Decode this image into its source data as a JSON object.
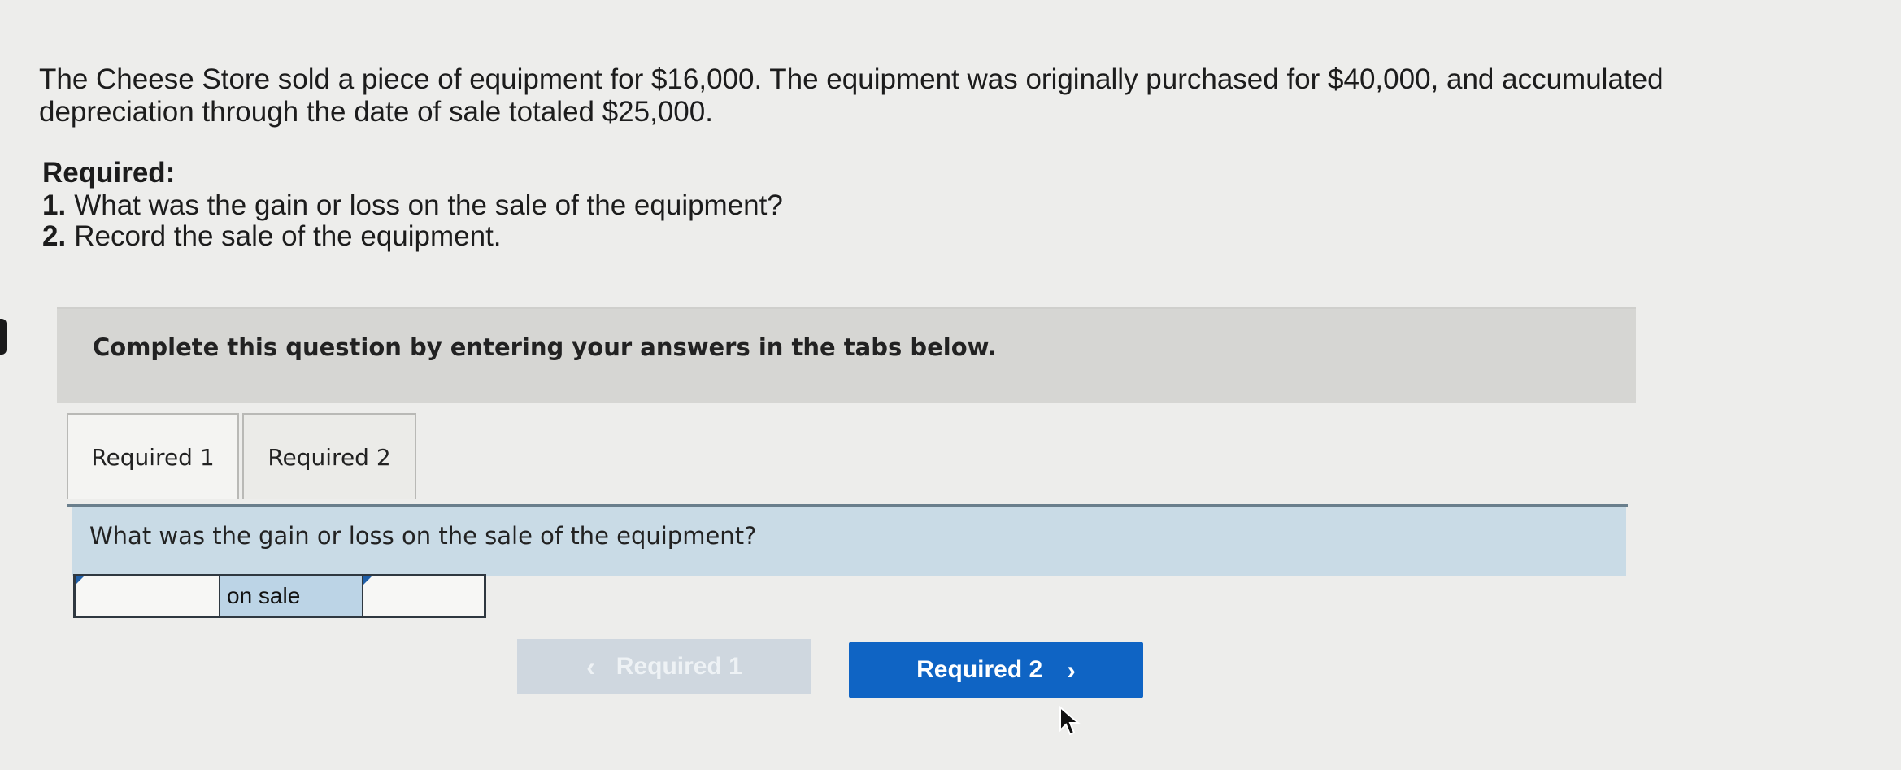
{
  "problem": {
    "text": "The Cheese Store sold a piece of equipment for $16,000. The equipment was originally purchased for $40,000, and accumulated depreciation through the date of sale totaled $25,000."
  },
  "required": {
    "title": "Required:",
    "items": [
      {
        "num": "1.",
        "text": "What was the gain or loss on the sale of the equipment?"
      },
      {
        "num": "2.",
        "text": "Record the sale of the equipment."
      }
    ]
  },
  "instruction": "Complete this question by entering your answers in the tabs below.",
  "tabs": [
    {
      "label": "Required 1"
    },
    {
      "label": "Required 2"
    }
  ],
  "question": "What was the gain or loss on the sale of the equipment?",
  "answer": {
    "selected_value": "",
    "label": "on sale",
    "amount_value": ""
  },
  "nav": {
    "prev_label": "Required 1",
    "next_label": "Required 2",
    "prev_icon": "chevron-left-icon",
    "next_icon": "chevron-right-icon"
  },
  "colors": {
    "accent": "#0f64c4",
    "question_bar": "#c9dbe6",
    "instruction_bg": "#d6d6d3",
    "disabled_button": "#cfd7df"
  }
}
